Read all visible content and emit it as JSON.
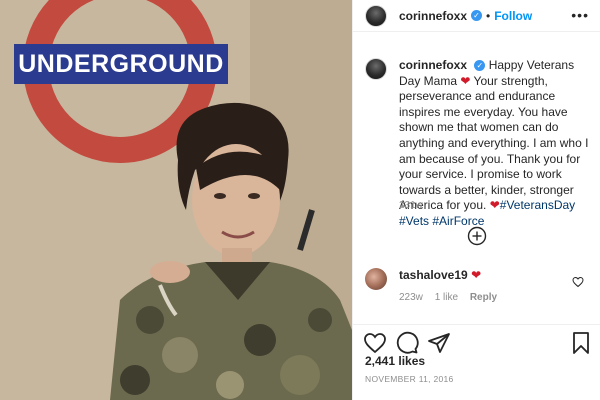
{
  "photo": {
    "sign_text": "UNDERGROUND"
  },
  "header": {
    "username": "corinnefoxx",
    "separator": "•",
    "follow_label": "Follow",
    "more_label": "•••"
  },
  "caption": {
    "username": "corinnefoxx",
    "text_part1": "Happy Veterans Day Mama",
    "heart1": "❤",
    "text_part2": "Your strength, perseverance and endurance inspires me everyday. You have shown me that women can do anything and everything. I am who I am because of you. Thank you for your service. I promise to work towards a better, kinder, stronger America for you.",
    "heart2": "❤",
    "tags": [
      "#VeteransDay",
      "#Vets",
      "#AirForce"
    ],
    "time": "231w"
  },
  "comment": {
    "username": "tashalove19",
    "emoji": "❤",
    "time": "223w",
    "likes": "1 like",
    "reply_label": "Reply"
  },
  "footer": {
    "likes_count": "2,441 likes",
    "date": "NOVEMBER 11, 2016"
  },
  "colors": {
    "link_blue": "#0095f6",
    "verified_blue": "#3897f0",
    "hashtag": "#00376b",
    "roundel_red": "#c0392b",
    "roundel_bar": "#2b3b8f"
  },
  "icons": [
    "verified-badge-icon",
    "more-options-icon",
    "add-circle-icon",
    "heart-outline-icon",
    "comment-icon",
    "share-icon",
    "bookmark-icon"
  ]
}
